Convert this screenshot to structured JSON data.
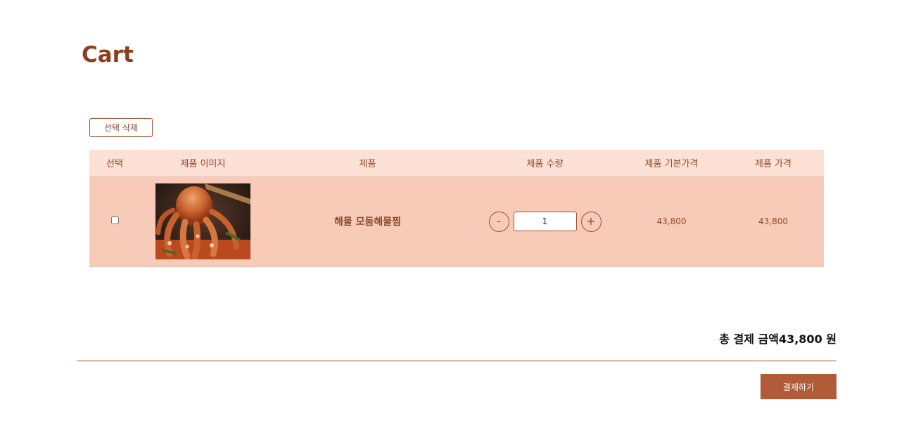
{
  "page": {
    "title": "Cart"
  },
  "toolbar": {
    "delete_selected_label": "선택 삭제"
  },
  "table": {
    "headers": {
      "select": "선택",
      "image": "제품 이미지",
      "product": "제품",
      "quantity": "제품 수량",
      "base_price": "제품 기본가격",
      "price": "제품 가격"
    },
    "rows": [
      {
        "checked": false,
        "product_name": "해물 모둠해물찜",
        "quantity": "1",
        "base_price": "43,800",
        "price": "43,800",
        "decrement_label": "-",
        "increment_label": "+"
      }
    ]
  },
  "summary": {
    "total_label": "총 결제 금액",
    "total_value": "43,800 원"
  },
  "checkout": {
    "pay_label": "결제하기"
  },
  "colors": {
    "accent": "#a0522d",
    "header_bg": "#fde0d6",
    "row_bg": "#f8cbb9",
    "pay_button": "#b05c38"
  }
}
